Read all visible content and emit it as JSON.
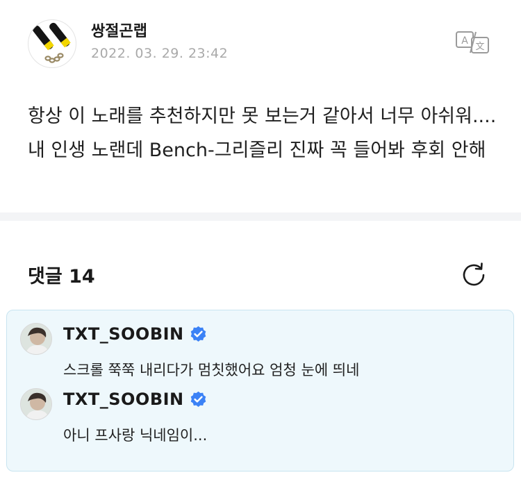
{
  "post": {
    "author": "쌍절곤랩",
    "date": "2022. 03. 29. 23:42",
    "body": "항상 이 노래를 추천하지만 못 보는거 같아서 너무 아쉬워....내 인생 노랜데 Bench-그리즐리 진짜 꼭 들어봐 후회 안해",
    "translate_icon": "translate-icon"
  },
  "comments": {
    "title": "댓글 14",
    "refresh_icon": "refresh-icon",
    "items": [
      {
        "username": "TXT_SOOBIN",
        "verified": true,
        "text": "스크롤 쭉쭉 내리다가 멈칫했어요 엄청 눈에 띄네"
      },
      {
        "username": "TXT_SOOBIN",
        "verified": true,
        "text": "아니 프사랑 닉네임이..."
      }
    ]
  },
  "colors": {
    "verified_badge": "#3b82f6",
    "comment_bg": "#eef8fc",
    "comment_border": "#c8e4f0",
    "date_gray": "#a9a9a9"
  }
}
